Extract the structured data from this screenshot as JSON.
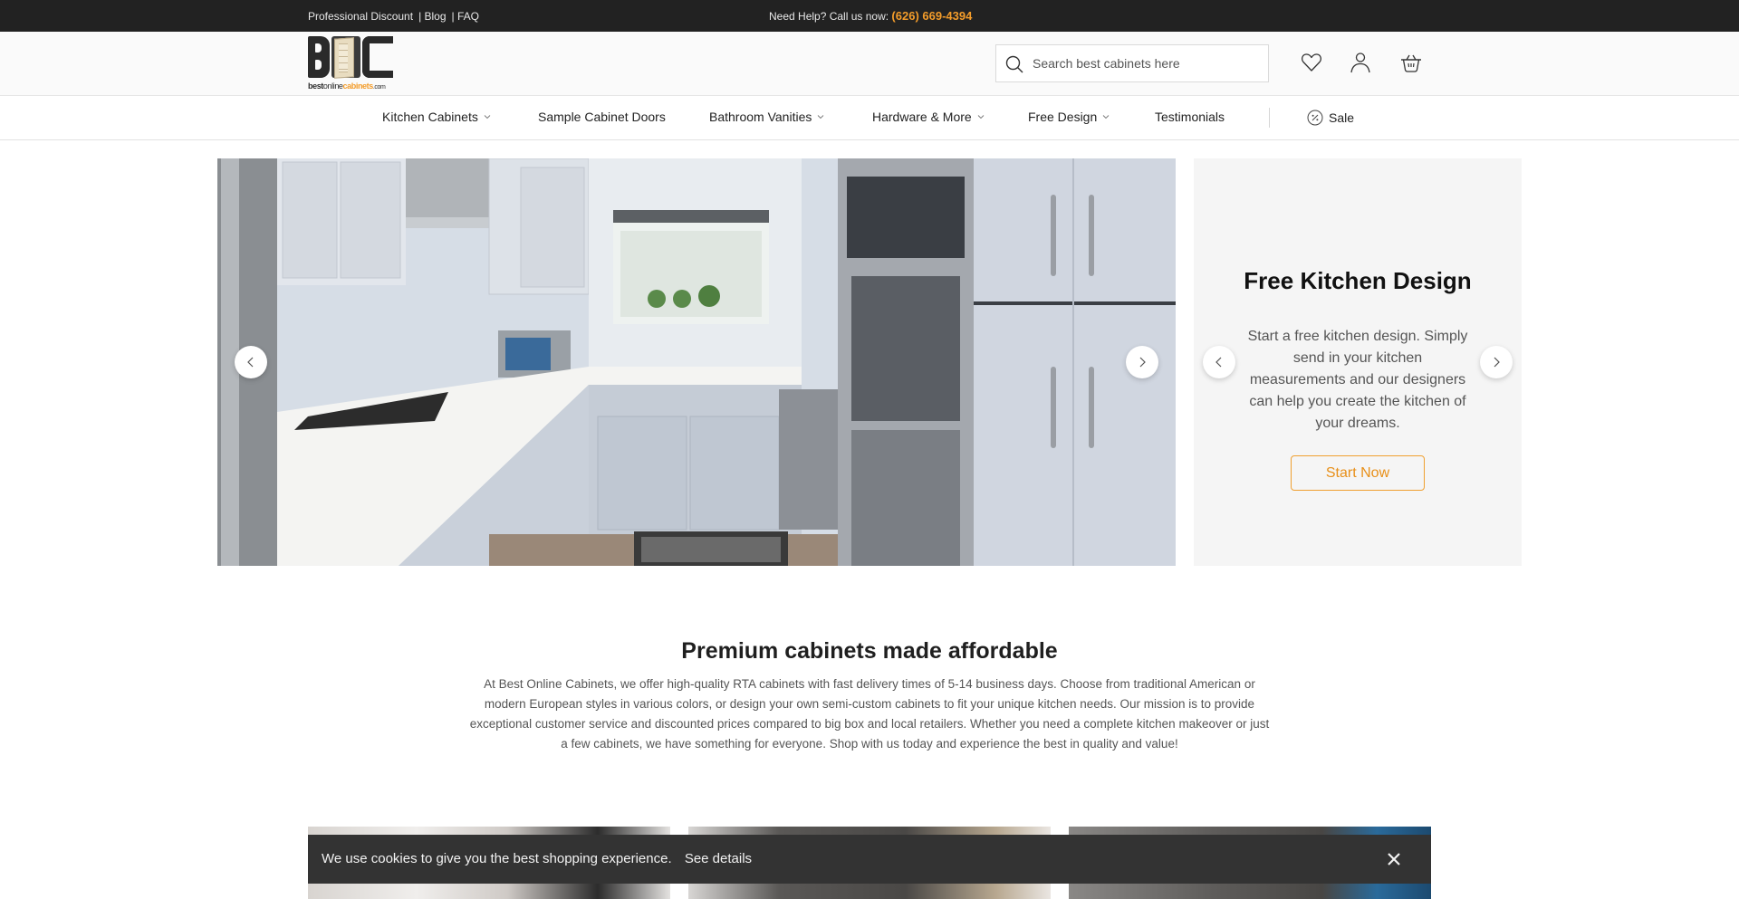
{
  "topbar": {
    "links": [
      "Professional Discount",
      "| Blog",
      "| FAQ"
    ],
    "help_text": "Need Help? Call us now:",
    "phone": "(626) 669-4394"
  },
  "header": {
    "logo": {
      "alt": "BOC",
      "url_parts": [
        "best",
        "online",
        "cabinets",
        ".com"
      ]
    },
    "search": {
      "placeholder": "Search best cabinets here",
      "value": ""
    },
    "icons": [
      "heart-icon",
      "user-icon",
      "basket-icon"
    ]
  },
  "nav": {
    "items": [
      {
        "label": "Kitchen Cabinets",
        "dropdown": true
      },
      {
        "label": "Sample Cabinet Doors",
        "dropdown": false
      },
      {
        "label": "Bathroom Vanities",
        "dropdown": true
      },
      {
        "label": "Hardware & More",
        "dropdown": true
      },
      {
        "label": "Free Design",
        "dropdown": true
      },
      {
        "label": "Testimonials",
        "dropdown": false
      }
    ],
    "sale": {
      "label": "Sale",
      "icon": "percent-badge-icon"
    }
  },
  "hero": {
    "image_alt": "White shaker kitchen with stainless appliances",
    "promo": {
      "title": "Free Kitchen Design",
      "text": "Start a free kitchen design. Simply send in your kitchen measurements and our designers can help you create the kitchen of your dreams.",
      "button": "Start Now"
    }
  },
  "intro": {
    "title": "Premium cabinets made affordable",
    "text": "At Best Online Cabinets, we offer high-quality RTA cabinets with fast delivery times of 5-14 business days. Choose from traditional American or modern European styles in various colors, or design your own semi-custom cabinets to fit your unique kitchen needs. Our mission is to provide exceptional customer service and discounted prices compared to big box and local retailers. Whether you need a complete kitchen makeover or just a few cabinets, we have something for everyone. Shop with us today and experience the best in quality and value!"
  },
  "cookie": {
    "message": "We use cookies to give you the best shopping experience.",
    "details_link": "See details"
  },
  "colors": {
    "accent": "#f39c2a",
    "topbar_bg": "#222222",
    "cookie_bg": "#333333",
    "promo_bg": "#f5f5f5"
  }
}
